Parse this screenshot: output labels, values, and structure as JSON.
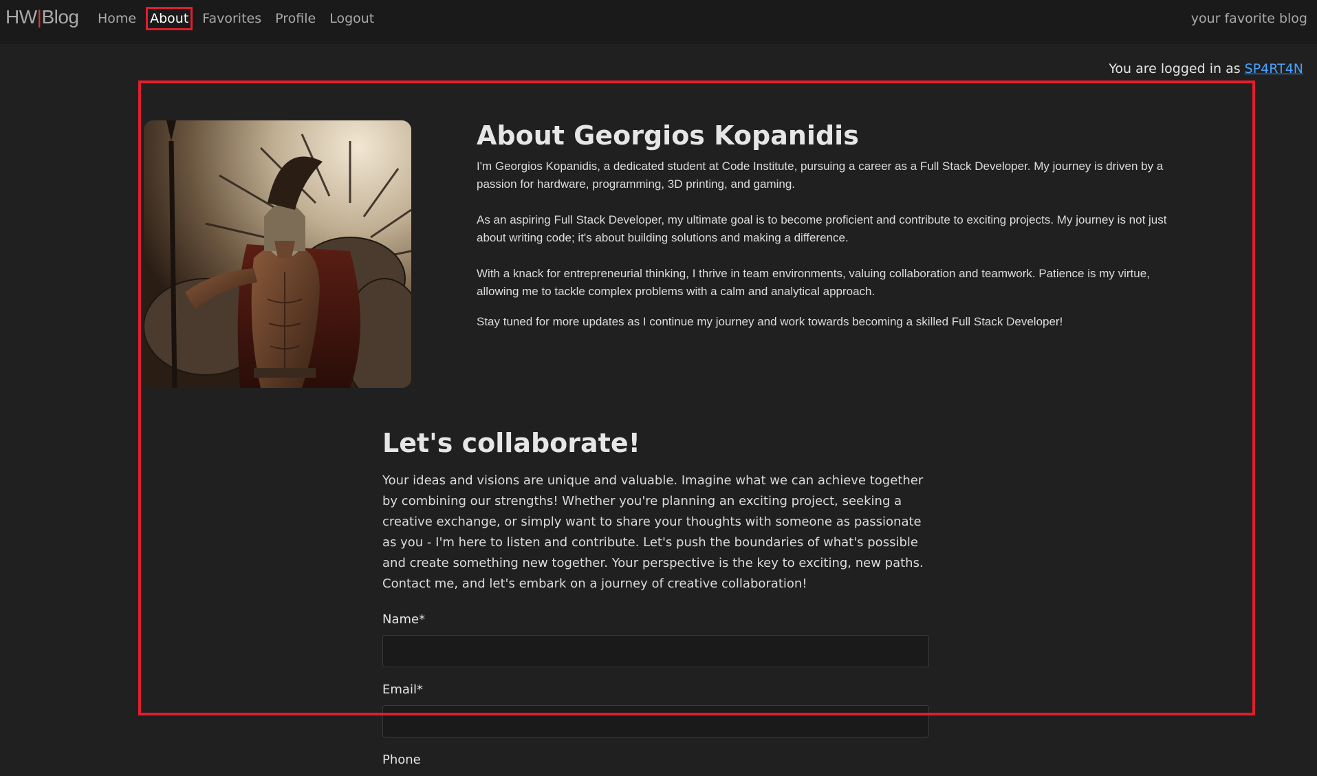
{
  "navbar": {
    "brand": "HW|Blog",
    "brand_left": "HW",
    "brand_sep": "|",
    "brand_right": "Blog",
    "links": [
      "Home",
      "About",
      "Favorites",
      "Profile",
      "Logout"
    ],
    "active": "About",
    "tagline": "your favorite blog"
  },
  "login": {
    "prefix": "You are logged in as ",
    "username": "SP4RT4N"
  },
  "about": {
    "title": "About Georgios Kopanidis",
    "paragraphs": [
      "I'm Georgios Kopanidis, a dedicated student at Code Institute, pursuing a career as a Full Stack Developer. My journey is driven by a passion for hardware, programming, 3D printing, and gaming.",
      "As an aspiring Full Stack Developer, my ultimate goal is to become proficient and contribute to exciting projects. My journey is not just about writing code; it's about building solutions and making a difference.",
      "With a knack for entrepreneurial thinking, I thrive in team environments, valuing collaboration and teamwork. Patience is my virtue, allowing me to tackle complex problems with a calm and analytical approach.",
      "Stay tuned for more updates as I continue my journey and work towards becoming a skilled Full Stack Developer!"
    ]
  },
  "collab": {
    "title": "Let's collaborate!",
    "text": "Your ideas and visions are unique and valuable. Imagine what we can achieve together by combining our strengths! Whether you're planning an exciting project, seeking a creative exchange, or simply want to share your thoughts with someone as passionate as you - I'm here to listen and contribute. Let's push the boundaries of what's possible and create something new together. Your perspective is the key to exciting, new paths. Contact me, and let's embark on a journey of creative collaboration!",
    "fields": [
      {
        "label": "Name*",
        "value": ""
      },
      {
        "label": "Email*",
        "value": ""
      },
      {
        "label": "Phone",
        "value": ""
      }
    ]
  },
  "colors": {
    "background": "#202020",
    "navbar": "#1a1a1a",
    "highlight": "#e01e2e",
    "link": "#4aa3ff"
  }
}
